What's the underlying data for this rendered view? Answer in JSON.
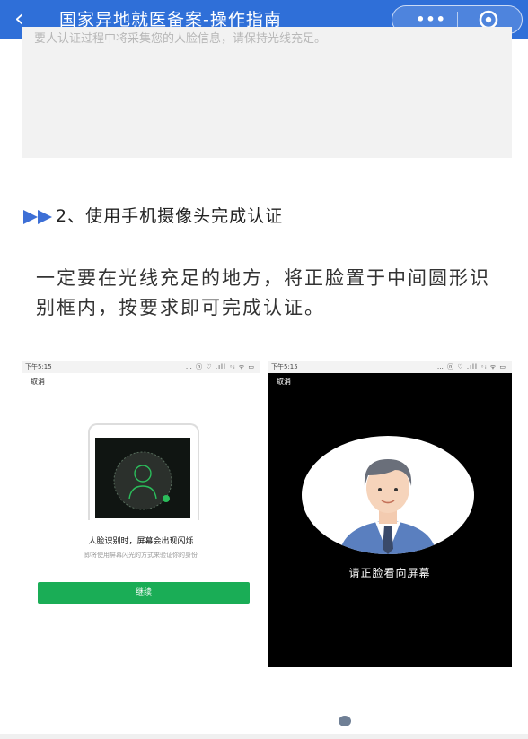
{
  "navbar": {
    "back_icon": "‹",
    "title": "国家异地就医备案-操作指南",
    "more_label": "•••",
    "bg_color": "#2f6fd8"
  },
  "prev_card": {
    "text": "要人认证过程中将采集您的人脸信息，请保持光线充足。"
  },
  "section": {
    "title": "2、使用手机摄像头完成认证"
  },
  "paragraph": {
    "text": "一定要在光线充足的地方，将正脸置于中间圆形识别框内，按要求即可完成认证。"
  },
  "screenshot_left": {
    "status_time": "下午5:15",
    "status_icons": "… ⓝ ♡ .ıll ◦ᵢ ᯤ ▭",
    "cancel": "取消",
    "tip_title": "人脸识别时，屏幕会出现闪烁",
    "tip_sub": "即将使用屏幕闪光的方式来验证你的身份",
    "continue_button": "继续",
    "button_color": "#1aad56"
  },
  "screenshot_right": {
    "status_time": "下午5:15",
    "status_icons": "… ⓝ ♡ .ıll ◦ᵢ ᯤ ▭",
    "cancel": "取消",
    "face_tip": "请正脸看向屏幕"
  }
}
